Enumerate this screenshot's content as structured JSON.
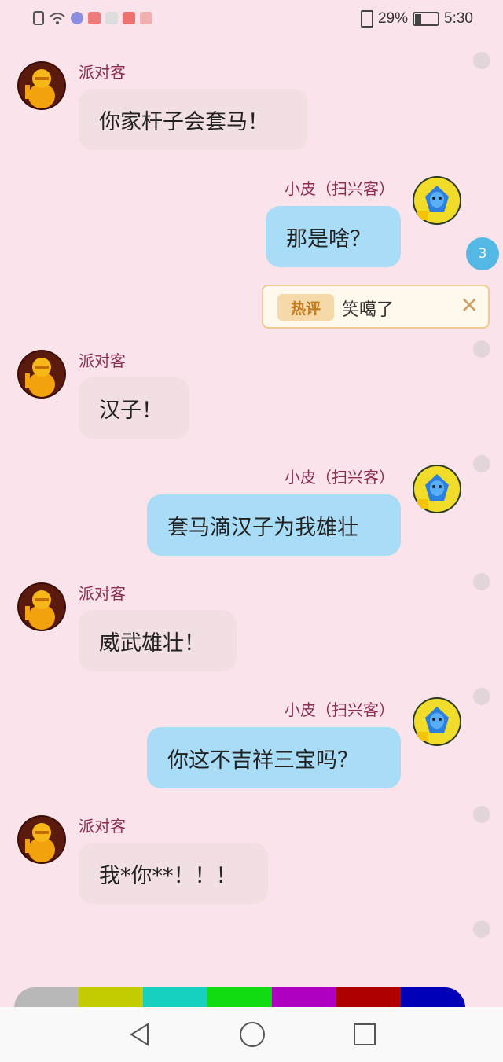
{
  "status_bar": {
    "battery_percent": "29%",
    "time": "5:30"
  },
  "messages": [
    {
      "sender": "派对客",
      "text": "你家杆子会套马！",
      "direction": "in"
    },
    {
      "sender": "小皮（扫兴客）",
      "text": "那是啥？",
      "direction": "out"
    },
    {
      "sender": "派对客",
      "text": "汉子！",
      "direction": "in"
    },
    {
      "sender": "小皮（扫兴客）",
      "text": "套马滴汉子为我雄壮",
      "direction": "out"
    },
    {
      "sender": "派对客",
      "text": "威武雄壮！",
      "direction": "in"
    },
    {
      "sender": "小皮（扫兴客）",
      "text": "你这不吉祥三宝吗？",
      "direction": "out"
    },
    {
      "sender": "派对客",
      "text": "我*你**！！！",
      "direction": "in"
    }
  ],
  "hot_comment": {
    "tag": "热评",
    "text": "笑噶了",
    "count": "3"
  },
  "palette_colors": [
    "#b8b8b8",
    "#c2cc00",
    "#17d2c0",
    "#10dc10",
    "#b000c4",
    "#b00000",
    "#0000b8"
  ]
}
